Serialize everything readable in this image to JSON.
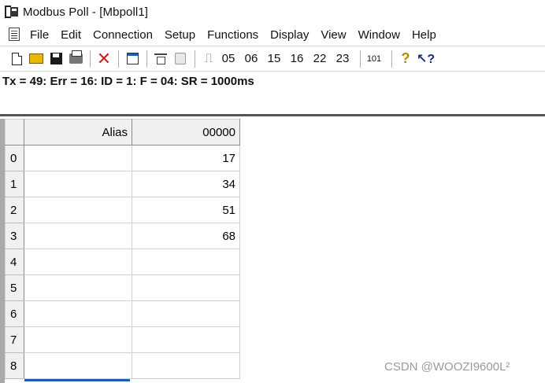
{
  "window": {
    "title": "Modbus Poll - [Mbpoll1]"
  },
  "menu": {
    "items": [
      "File",
      "Edit",
      "Connection",
      "Setup",
      "Functions",
      "Display",
      "View",
      "Window",
      "Help"
    ]
  },
  "toolbar": {
    "icons": [
      "new-icon",
      "open-folder-icon",
      "save-icon",
      "print-icon",
      "delete-x-icon",
      "window-icon",
      "connect-icon",
      "disconnect-icon",
      "pulse-icon"
    ],
    "function_codes": [
      "05",
      "06",
      "15",
      "16",
      "22",
      "23"
    ],
    "readwrite_label": "101",
    "help_icon": "help-icon",
    "whatis_icon": "whats-this-icon"
  },
  "status": {
    "text": "Tx = 49: Err = 16: ID = 1: F = 04: SR = 1000ms"
  },
  "grid": {
    "columns": [
      "Alias",
      "00000"
    ],
    "rows": [
      {
        "index": "0",
        "alias": "",
        "value": "17"
      },
      {
        "index": "1",
        "alias": "",
        "value": "34"
      },
      {
        "index": "2",
        "alias": "",
        "value": "51"
      },
      {
        "index": "3",
        "alias": "",
        "value": "68"
      },
      {
        "index": "4",
        "alias": "",
        "value": ""
      },
      {
        "index": "5",
        "alias": "",
        "value": ""
      },
      {
        "index": "6",
        "alias": "",
        "value": ""
      },
      {
        "index": "7",
        "alias": "",
        "value": ""
      },
      {
        "index": "8",
        "alias": "",
        "value": ""
      }
    ]
  },
  "watermark": {
    "text": "CSDN @WOOZI9600L²"
  }
}
